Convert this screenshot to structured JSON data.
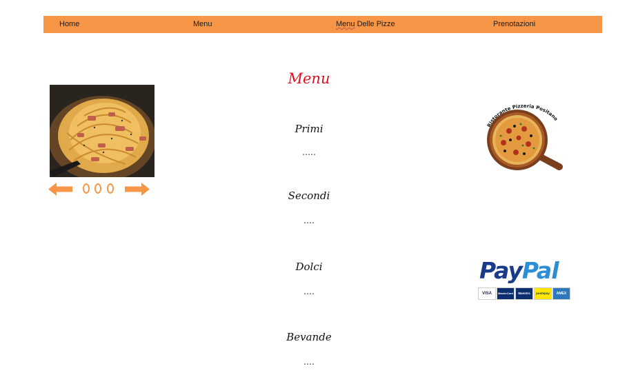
{
  "nav": {
    "home": "Home",
    "menu": "Menu",
    "pizza_menu_word1": "Menu",
    "pizza_menu_word2": "Delle Pizze",
    "reservations": "Prenotazioni"
  },
  "main": {
    "title": "Menu",
    "sections": [
      {
        "name": "Primi",
        "content": "…..",
        "content_sep": "…."
      },
      {
        "name": "Secondi",
        "content": "….",
        "content_sep": "…."
      },
      {
        "name": "Dolci",
        "content": "….",
        "content_sep": "…."
      },
      {
        "name": "Bevande",
        "content": "….",
        "content_sep": "…."
      }
    ]
  },
  "logo": {
    "text": "Ristorante Pizzeria Positano"
  },
  "payment": {
    "brand_pay": "Pay",
    "brand_pal": "Pal",
    "cards": [
      "VISA",
      "MasterCard",
      "Maestro",
      "postepay",
      "AMEX"
    ]
  },
  "colors": {
    "nav_bg": "#f79646",
    "title_red": "#e0101e",
    "accent_orange": "#f79646"
  },
  "icons": {
    "prev": "arrow-left-icon",
    "next": "arrow-right-icon"
  }
}
